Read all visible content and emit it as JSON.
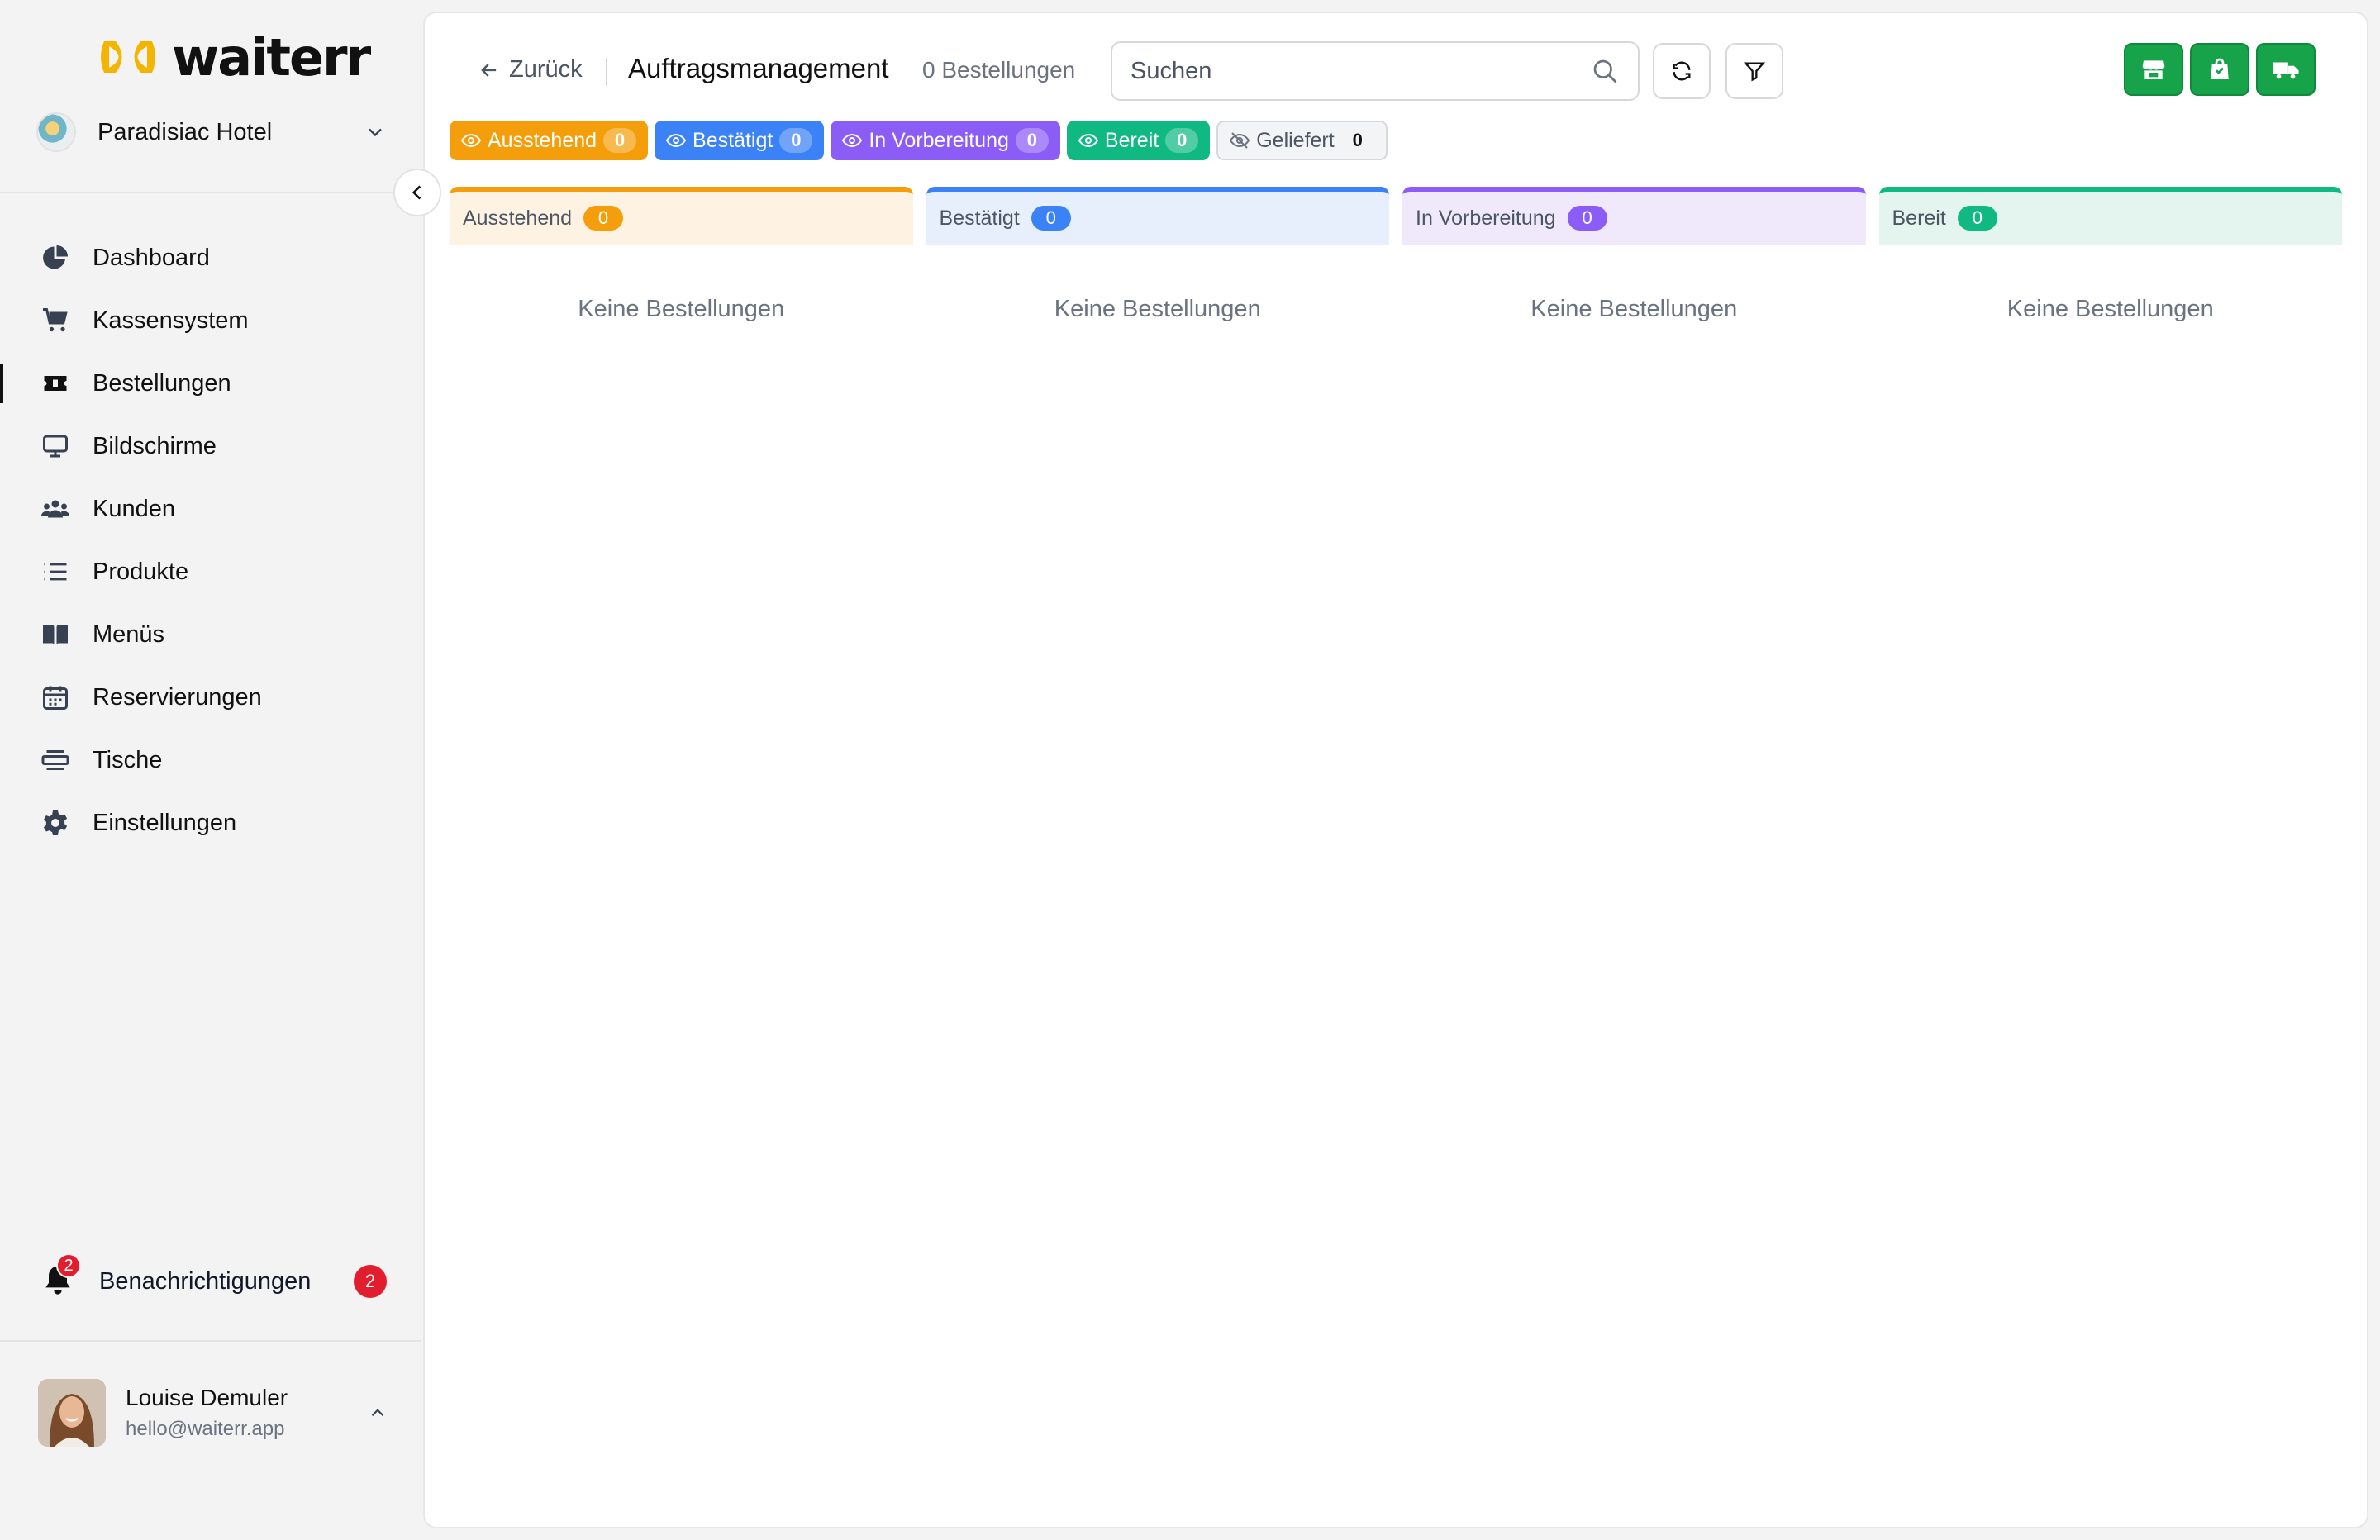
{
  "brand": {
    "name": "waiterr"
  },
  "venue": {
    "name": "Paradisiac Hotel"
  },
  "nav": {
    "items": [
      {
        "label": "Dashboard",
        "icon": "pie-chart-icon",
        "active": false
      },
      {
        "label": "Kassensystem",
        "icon": "cart-icon",
        "active": false
      },
      {
        "label": "Bestellungen",
        "icon": "ticket-icon",
        "active": true
      },
      {
        "label": "Bildschirme",
        "icon": "monitor-icon",
        "active": false
      },
      {
        "label": "Kunden",
        "icon": "users-icon",
        "active": false
      },
      {
        "label": "Produkte",
        "icon": "list-icon",
        "active": false
      },
      {
        "label": "Menüs",
        "icon": "book-icon",
        "active": false
      },
      {
        "label": "Reservierungen",
        "icon": "calendar-icon",
        "active": false
      },
      {
        "label": "Tische",
        "icon": "table-icon",
        "active": false
      },
      {
        "label": "Einstellungen",
        "icon": "gear-icon",
        "active": false
      }
    ]
  },
  "notifications": {
    "label": "Benachrichtigungen",
    "count": "2"
  },
  "user": {
    "name": "Louise Demuler",
    "email": "hello@waiterr.app"
  },
  "header": {
    "back_label": "Zurück",
    "title": "Auftragsmanagement",
    "order_count": "0 Bestellungen",
    "search_placeholder": "Suchen",
    "search_value": ""
  },
  "filters": [
    {
      "label": "Ausstehend",
      "count": "0",
      "color": "#f59e0b",
      "enabled": true
    },
    {
      "label": "Bestätigt",
      "count": "0",
      "color": "#3b82f6",
      "enabled": true
    },
    {
      "label": "In Vorbereitung",
      "count": "0",
      "color": "#8b5cf6",
      "enabled": true
    },
    {
      "label": "Bereit",
      "count": "0",
      "color": "#10b981",
      "enabled": true
    },
    {
      "label": "Geliefert",
      "count": "0",
      "color": "#6b7280",
      "enabled": false
    }
  ],
  "columns": [
    {
      "title": "Ausstehend",
      "count": "0",
      "accent": "#f59e0b",
      "bg": "#fef3e2",
      "empty_text": "Keine Bestellungen"
    },
    {
      "title": "Bestätigt",
      "count": "0",
      "accent": "#3b82f6",
      "bg": "#e8effc",
      "empty_text": "Keine Bestellungen"
    },
    {
      "title": "In Vorbereitung",
      "count": "0",
      "accent": "#8b5cf6",
      "bg": "#efe9fb",
      "empty_text": "Keine Bestellungen"
    },
    {
      "title": "Bereit",
      "count": "0",
      "accent": "#10b981",
      "bg": "#e3f5ee",
      "empty_text": "Keine Bestellungen"
    }
  ],
  "colors": {
    "action_green": "#16a34a",
    "notification_red": "#e11d2e"
  }
}
